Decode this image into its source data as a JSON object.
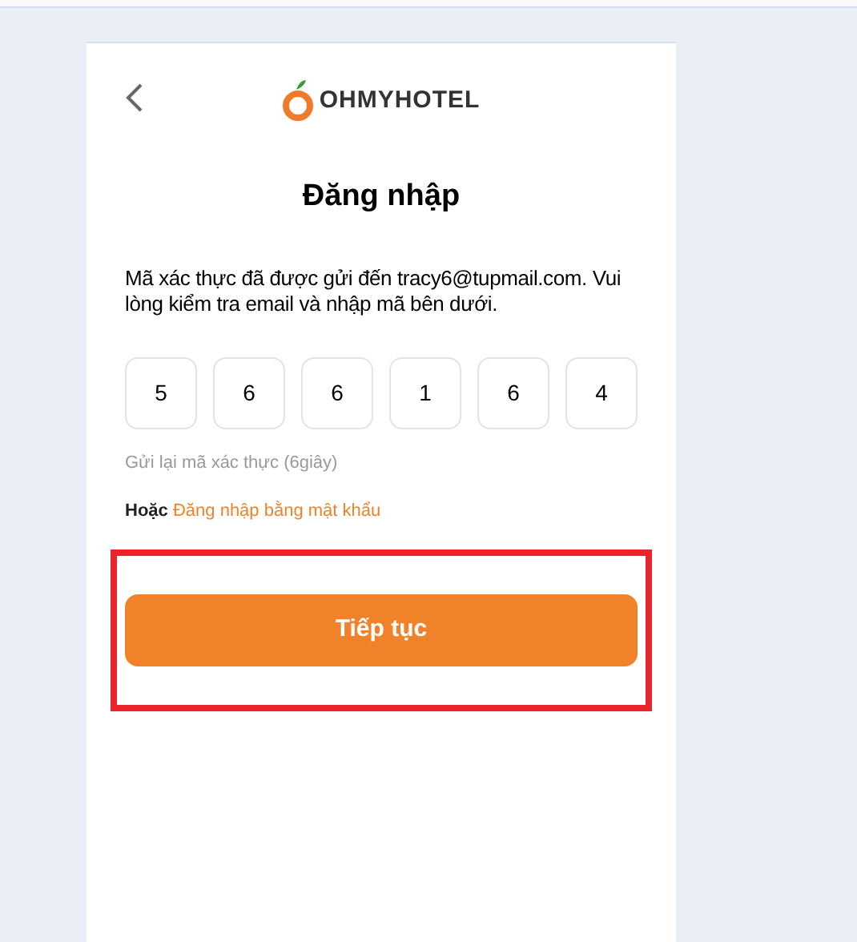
{
  "header": {
    "logo_text": "OHMYHOTEL"
  },
  "title": "Đăng nhập",
  "message": "Mã xác thực đã được gửi đến tracy6@tupmail.com. Vui lòng kiểm tra email và nhập mã bên dưới.",
  "code_digits": [
    "5",
    "6",
    "6",
    "1",
    "6",
    "4"
  ],
  "resend_text": "Gửi lại mã xác thực (6giây)",
  "alternative": {
    "prefix": "Hoặc",
    "link": "Đăng nhập bằng mật khẩu"
  },
  "continue_button": {
    "label": "Tiếp tục",
    "highlighted": true
  }
}
